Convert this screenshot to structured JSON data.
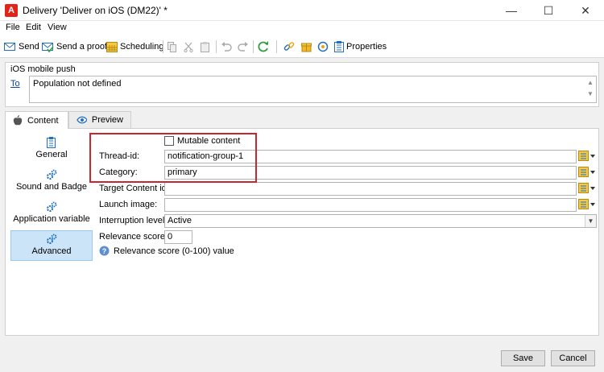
{
  "window": {
    "title": "Delivery 'Deliver on iOS (DM22)' *",
    "controls": {
      "minimize": "—",
      "maximize": "☐",
      "close": "✕"
    }
  },
  "menu": {
    "items": [
      "File",
      "Edit",
      "View"
    ]
  },
  "toolbar": {
    "send": "Send",
    "send_proof": "Send a proof",
    "scheduling": "Scheduling",
    "properties": "Properties"
  },
  "ios_push": {
    "group_title": "iOS mobile push",
    "to_label": "To",
    "population": "Population not defined"
  },
  "tabs": [
    {
      "label": "Content",
      "icon": "apple-icon"
    },
    {
      "label": "Preview",
      "icon": "eye-icon"
    }
  ],
  "sidebar": {
    "items": [
      {
        "label": "General",
        "icon": "document-icon"
      },
      {
        "label": "Sound and Badge",
        "icon": "gears-icon"
      },
      {
        "label": "Application variable",
        "icon": "gears-icon"
      },
      {
        "label": "Advanced",
        "icon": "gears-icon",
        "selected": true
      }
    ]
  },
  "form": {
    "mutable_content": {
      "label": "Mutable content",
      "checked": false
    },
    "thread_id": {
      "label": "Thread-id:",
      "value": "notification-group-1"
    },
    "category": {
      "label": "Category:",
      "value": "primary"
    },
    "target_content_id": {
      "label": "Target Content id:",
      "value": ""
    },
    "launch_image": {
      "label": "Launch image:",
      "value": ""
    },
    "interruption_level": {
      "label": "Interruption level:",
      "value": "Active"
    },
    "relevance_score": {
      "label": "Relevance score:",
      "value": "0"
    },
    "relevance_hint": "Relevance score (0-100) value"
  },
  "footer": {
    "save": "Save",
    "cancel": "Cancel"
  },
  "colors": {
    "highlight": "#c8282d",
    "selected_bg": "#cce4f7",
    "link": "#0645ad",
    "accent_red": "#e2231a"
  }
}
